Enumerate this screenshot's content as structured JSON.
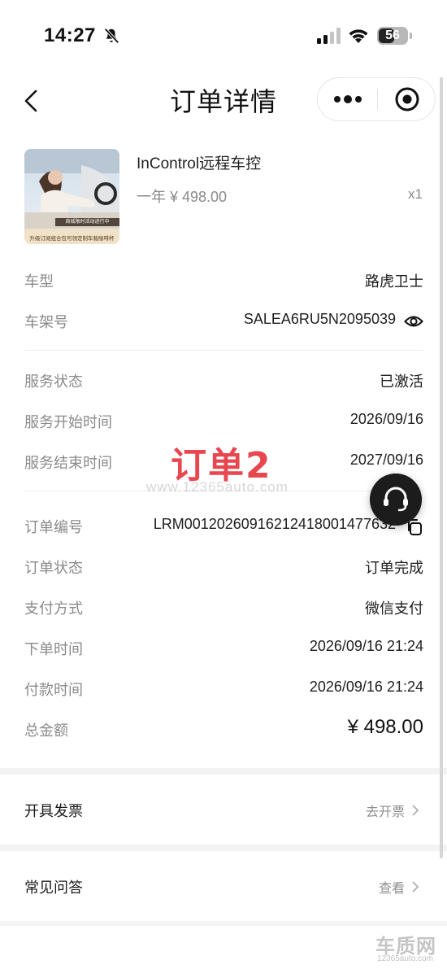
{
  "status_bar": {
    "time": "14:27",
    "battery": "56",
    "battery_level": 0.56
  },
  "nav": {
    "title": "订单详情"
  },
  "product": {
    "name": "InControl远程车控",
    "price": "一年 ¥ 498.00",
    "quantity": "x1",
    "thumb_badge": "商城限时活动进行中",
    "thumb_caption": "升级订阅组合包可领定制车载咖啡杯"
  },
  "vehicle": {
    "model_label": "车型",
    "model_value": "路虎卫士",
    "vin_label": "车架号",
    "vin_value": "SALEA6RU5N2095039"
  },
  "service": {
    "status_label": "服务状态",
    "status_value": "已激活",
    "start_label": "服务开始时间",
    "start_value": "2026/09/16",
    "end_label": "服务结束时间",
    "end_value": "2027/09/16"
  },
  "order": {
    "number_label": "订单编号",
    "number_value": "LRM001202609162124180014776​32",
    "status_label": "订单状态",
    "status_value": "订单完成",
    "payment_label": "支付方式",
    "payment_value": "微信支付",
    "placed_label": "下单时间",
    "placed_value": "2026/09/16 21:24",
    "paid_label": "付款时间",
    "paid_value": "2026/09/16 21:24",
    "total_label": "总金额",
    "total_value": "¥ 498.00"
  },
  "links": {
    "invoice_label": "开具发票",
    "invoice_action": "去开票",
    "faq_label": "常见问答",
    "faq_action": "查看"
  },
  "watermarks": {
    "order_tag": "订单2",
    "site": "www.12365auto.com",
    "logo_cn": "车质网",
    "logo_url": "12365auto.com"
  },
  "colors": {
    "watermark_red": "#e8474f",
    "label_gray": "#8a8a8a",
    "fab_dark": "#1c1c1c"
  }
}
